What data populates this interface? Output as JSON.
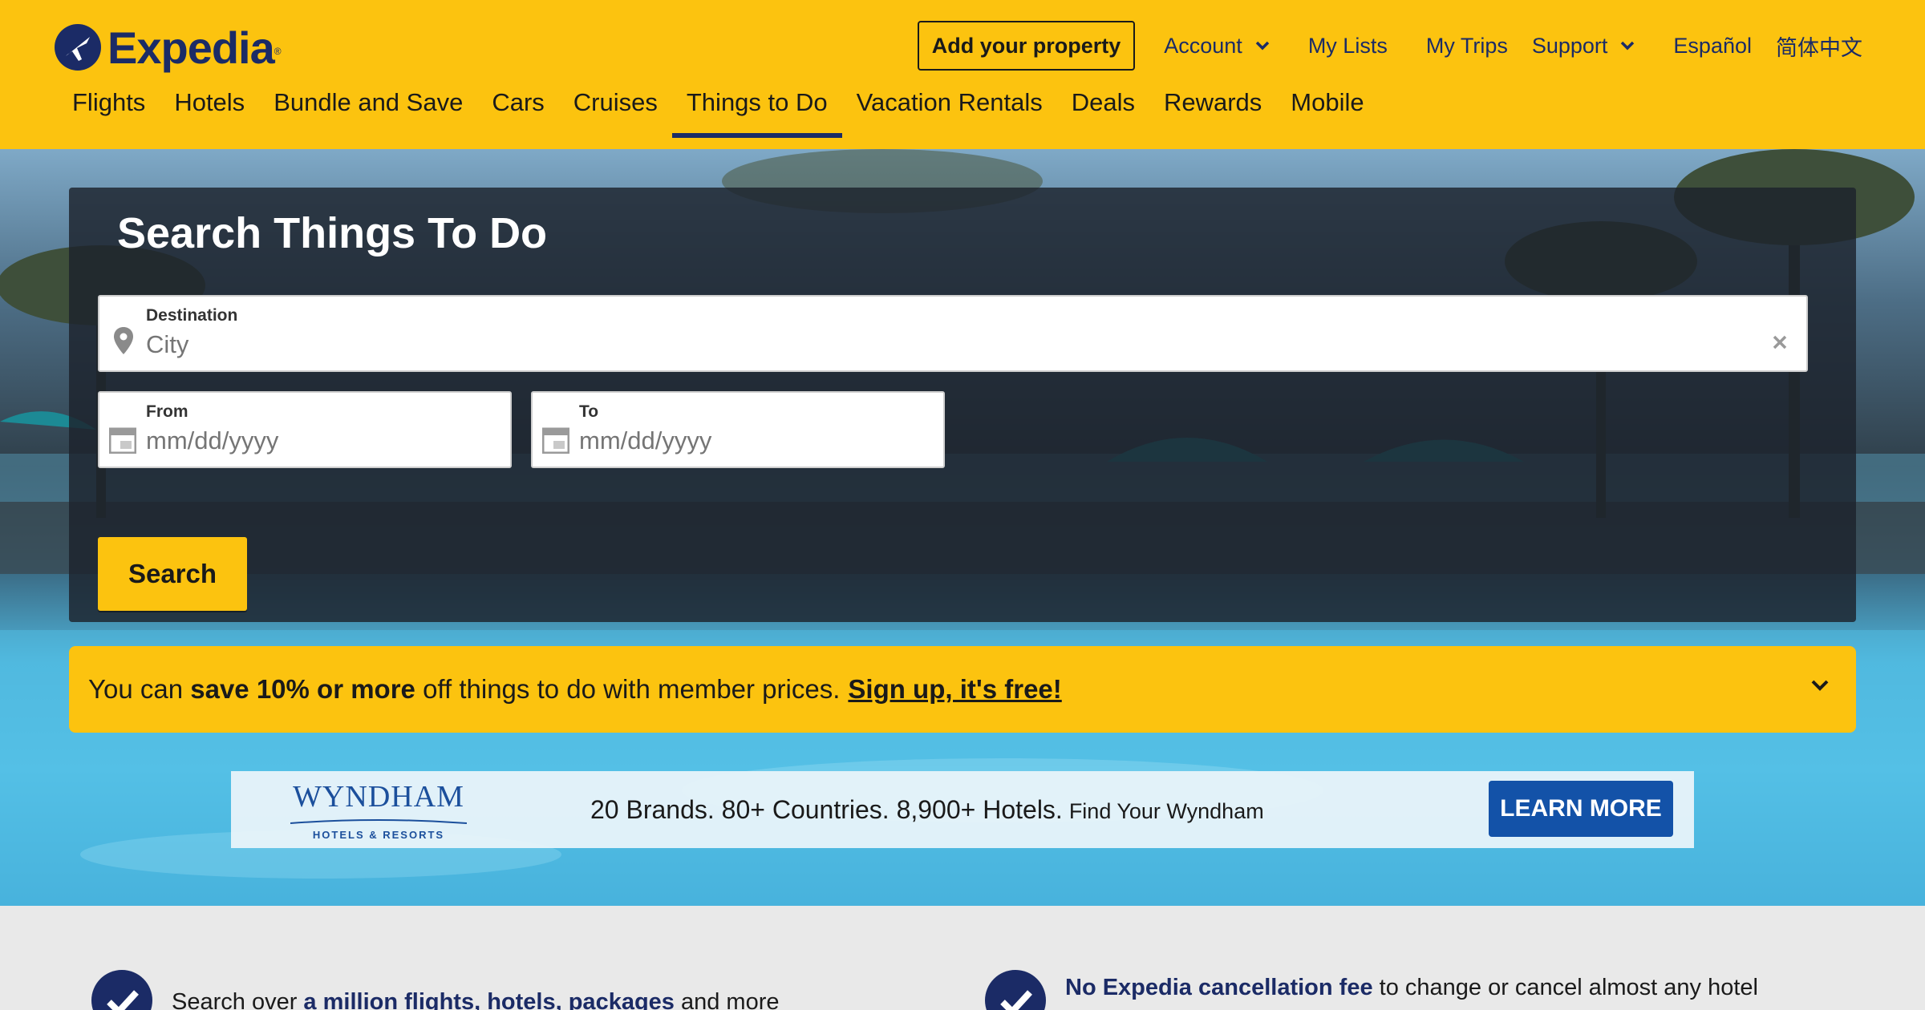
{
  "brand": {
    "name": "Expedia",
    "trademark": "®",
    "primary_color": "#fcc30f",
    "navy": "#1b2b66"
  },
  "utility_nav": {
    "add_property": "Add your property",
    "account": "Account",
    "my_lists": "My Lists",
    "my_trips": "My Trips",
    "support": "Support",
    "espanol": "Español",
    "chinese": "简体中文"
  },
  "main_nav": {
    "tabs": [
      {
        "label": "Flights"
      },
      {
        "label": "Hotels"
      },
      {
        "label": "Bundle and Save"
      },
      {
        "label": "Cars"
      },
      {
        "label": "Cruises"
      },
      {
        "label": "Things to Do",
        "active": true
      },
      {
        "label": "Vacation Rentals"
      },
      {
        "label": "Deals"
      },
      {
        "label": "Rewards"
      },
      {
        "label": "Mobile"
      }
    ]
  },
  "search": {
    "title": "Search Things To Do",
    "destination": {
      "label": "Destination",
      "placeholder": "City",
      "value": ""
    },
    "from": {
      "label": "From",
      "placeholder": "mm/dd/yyyy",
      "value": ""
    },
    "to": {
      "label": "To",
      "placeholder": "mm/dd/yyyy",
      "value": ""
    },
    "button": "Search"
  },
  "promo": {
    "prefix": "You can",
    "bold": "save 10% or more",
    "suffix": "off things to do with member prices.",
    "link": "Sign up, it's free!"
  },
  "ad": {
    "logo": "WYNDHAM",
    "logo_sub": "HOTELS & RESORTS",
    "headline": "20 Brands. 80+ Countries. 8,900+ Hotels.",
    "tagline": "Find Your Wyndham",
    "cta": "LEARN MORE",
    "cta_color": "#1352a8"
  },
  "benefits": [
    {
      "pre": "Search over",
      "bold": "a million flights, hotels, packages",
      "post": "and more"
    },
    {
      "pre": "",
      "bold": "No Expedia cancellation fee",
      "post": "to change or cancel almost any hotel reservation"
    }
  ],
  "icons": [
    "logo-plane-icon",
    "chevron-down-icon",
    "location-pin-icon",
    "clear-icon",
    "calendar-icon",
    "checkmark-icon"
  ]
}
